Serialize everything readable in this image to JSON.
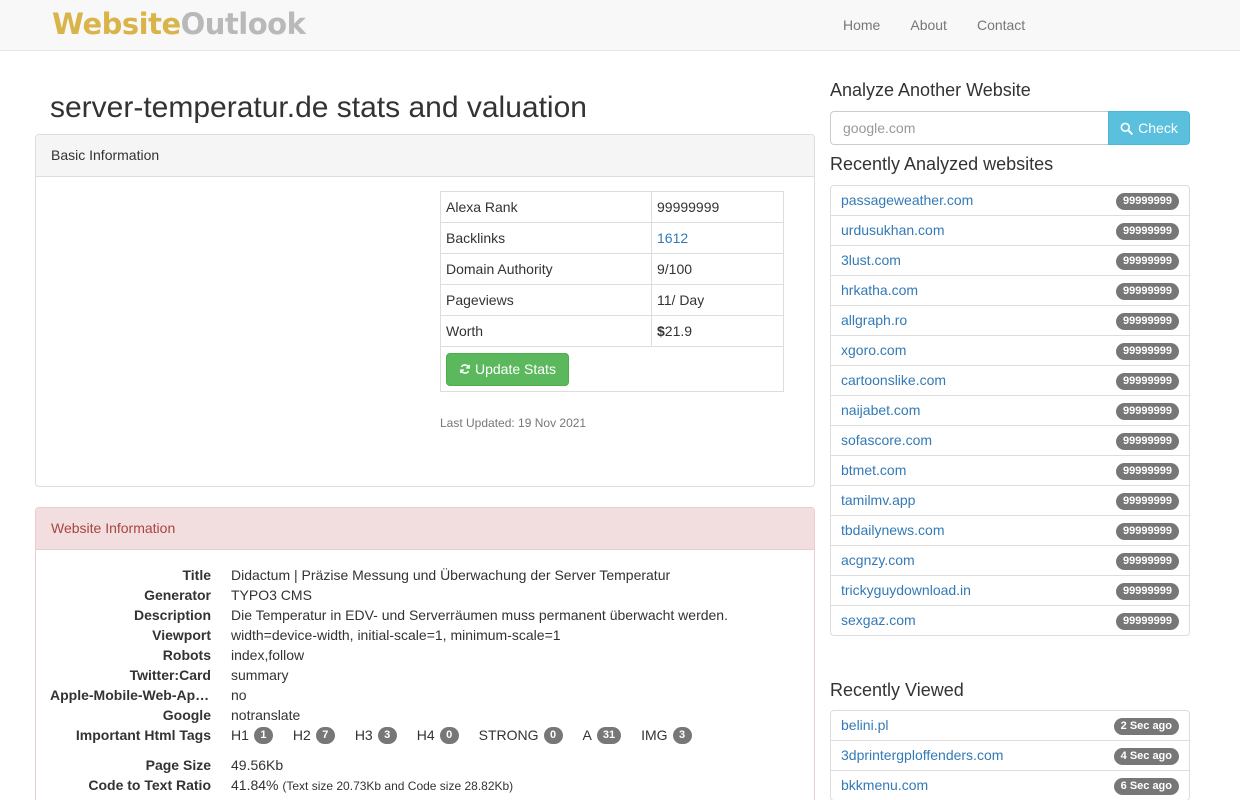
{
  "brand": {
    "part1": "Website",
    "part2": "Outlook"
  },
  "nav": [
    "Home",
    "About",
    "Contact"
  ],
  "page_title": "server-temperatur.de stats and valuation",
  "basic": {
    "heading": "Basic Information",
    "rows": [
      {
        "key": "Alexa Rank",
        "value": "99999999"
      },
      {
        "key": "Backlinks",
        "value": "1612"
      },
      {
        "key": "Domain Authority",
        "value": "9/100"
      },
      {
        "key": "Pageviews",
        "value": "11/ Day"
      },
      {
        "key": "Worth",
        "value": "21.9",
        "currency": "$"
      }
    ],
    "update_button": "Update Stats",
    "last_updated": "Last Updated: 19 Nov 2021"
  },
  "website_info": {
    "heading": "Website Information",
    "rows": [
      {
        "label": "Title",
        "value": "Didactum | Präzise Messung und Überwachung der Server Temperatur"
      },
      {
        "label": "Generator",
        "value": "TYPO3 CMS"
      },
      {
        "label": "Description",
        "value": "Die Temperatur in EDV- und Serverräumen muss permanent überwacht werden."
      },
      {
        "label": "Viewport",
        "value": "width=device-width, initial-scale=1, minimum-scale=1"
      },
      {
        "label": "Robots",
        "value": "index,follow"
      },
      {
        "label": "Twitter:Card",
        "value": "summary"
      },
      {
        "label": "Apple-Mobile-Web-App-Capable",
        "value": "no"
      },
      {
        "label": "Google",
        "value": "notranslate"
      }
    ],
    "tags_label": "Important Html Tags",
    "tags": [
      {
        "name": "H1",
        "count": "1"
      },
      {
        "name": "H2",
        "count": "7"
      },
      {
        "name": "H3",
        "count": "3"
      },
      {
        "name": "H4",
        "count": "0"
      },
      {
        "name": "STRONG",
        "count": "0"
      },
      {
        "name": "A",
        "count": "31"
      },
      {
        "name": "IMG",
        "count": "3"
      }
    ],
    "page_size_label": "Page Size",
    "page_size": "49.56Kb",
    "ratio_label": "Code to Text Ratio",
    "ratio": "41.84%",
    "ratio_note": "(Text size 20.73Kb and Code size 28.82Kb)"
  },
  "analyze": {
    "heading": "Analyze Another Website",
    "placeholder": "google.com",
    "button": "Check"
  },
  "recent": {
    "heading": "Recently Analyzed websites",
    "items": [
      {
        "site": "passageweather.com",
        "rank": "99999999"
      },
      {
        "site": "urdusukhan.com",
        "rank": "99999999"
      },
      {
        "site": "3lust.com",
        "rank": "99999999"
      },
      {
        "site": "hrkatha.com",
        "rank": "99999999"
      },
      {
        "site": "allgraph.ro",
        "rank": "99999999"
      },
      {
        "site": "xgoro.com",
        "rank": "99999999"
      },
      {
        "site": "cartoonslike.com",
        "rank": "99999999"
      },
      {
        "site": "naijabet.com",
        "rank": "99999999"
      },
      {
        "site": "sofascore.com",
        "rank": "99999999"
      },
      {
        "site": "btmet.com",
        "rank": "99999999"
      },
      {
        "site": "tamilmv.app",
        "rank": "99999999"
      },
      {
        "site": "tbdailynews.com",
        "rank": "99999999"
      },
      {
        "site": "acgnzy.com",
        "rank": "99999999"
      },
      {
        "site": "trickyguydownload.in",
        "rank": "99999999"
      },
      {
        "site": "sexgaz.com",
        "rank": "99999999"
      }
    ]
  },
  "viewed": {
    "heading": "Recently Viewed",
    "items": [
      {
        "site": "belini.pl",
        "time": "2 Sec ago"
      },
      {
        "site": "3dprintergploffenders.com",
        "time": "4 Sec ago"
      },
      {
        "site": "bkkmenu.com",
        "time": "6 Sec ago"
      }
    ]
  }
}
